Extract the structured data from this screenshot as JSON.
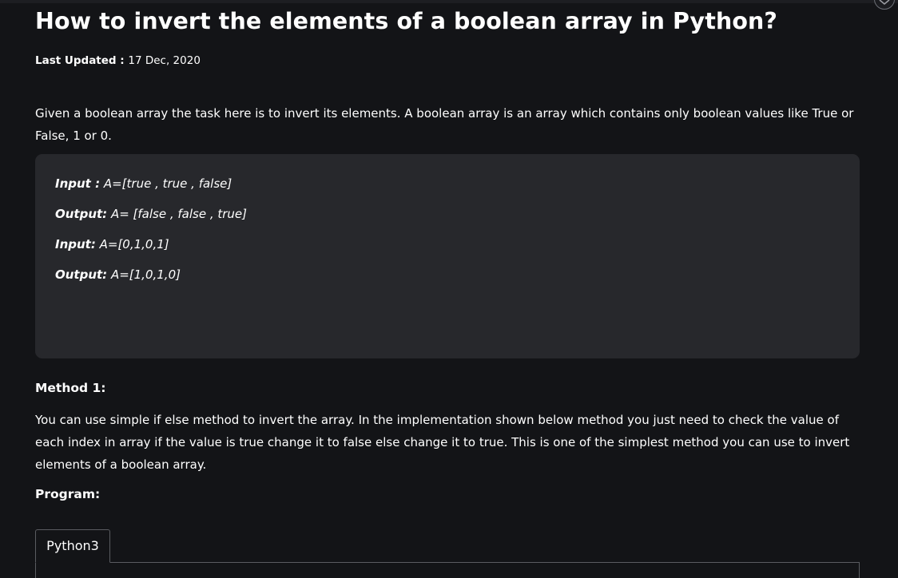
{
  "article": {
    "title": "How to invert the elements of a boolean array in Python?",
    "last_updated_label": "Last Updated :",
    "last_updated_date": "17 Dec, 2020",
    "intro": "Given a boolean array the task here is to invert its elements. A boolean array is an array which contains only boolean values like True or False, 1 or 0.",
    "examples": [
      {
        "label": "Input :",
        "value": " A=[true , true , false]"
      },
      {
        "label": "Output:",
        "value": " A= [false , false , true]"
      },
      {
        "label": "Input:",
        "value": " A=[0,1,0,1]"
      },
      {
        "label": "Output:",
        "value": " A=[1,0,1,0]"
      }
    ],
    "method1_heading": "Method 1:",
    "method1_text": "You can use simple if else method to invert the array. In the implementation shown below method you just need to check the value of each index in array if the value is true change it to false else change it to true. This is one of the simplest method you can use to invert elements of a boolean array.",
    "program_heading": "Program:",
    "code_tab_label": "Python3"
  },
  "icons": {
    "corner_button": "edit-pencil-icon"
  }
}
